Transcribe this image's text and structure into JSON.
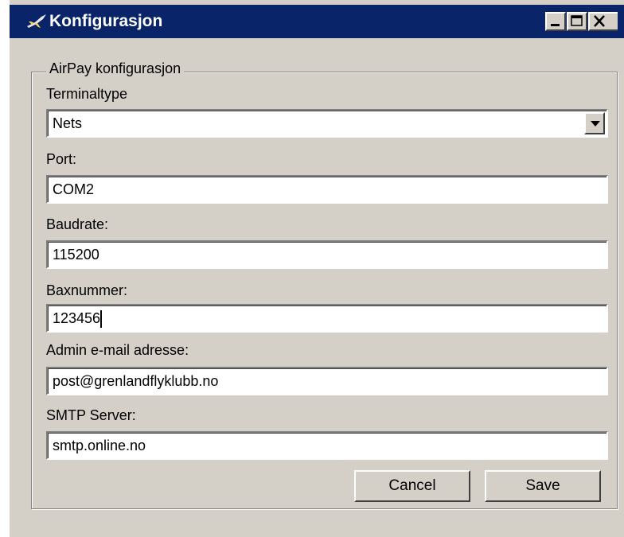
{
  "window": {
    "title": "Konfigurasjon",
    "title_icon": "plane-icon",
    "title_bar_color": "#0a246a",
    "controls": [
      "minimize-icon",
      "maximize-icon",
      "close-icon"
    ]
  },
  "group": {
    "legend": "AirPay konfigurasjon"
  },
  "fields": {
    "terminal_type": {
      "label": "Terminaltype",
      "value": "Nets"
    },
    "port": {
      "label": "Port:",
      "value": "COM2"
    },
    "baudrate": {
      "label": "Baudrate:",
      "value": "115200"
    },
    "baxnummer": {
      "label": "Baxnummer:",
      "value": "123456"
    },
    "admin_email": {
      "label": "Admin e-mail adresse:",
      "value": "post@grenlandflyklubb.no"
    },
    "smtp_server": {
      "label": "SMTP Server:",
      "value": "smtp.online.no"
    }
  },
  "buttons": {
    "cancel": "Cancel",
    "save": "Save"
  }
}
